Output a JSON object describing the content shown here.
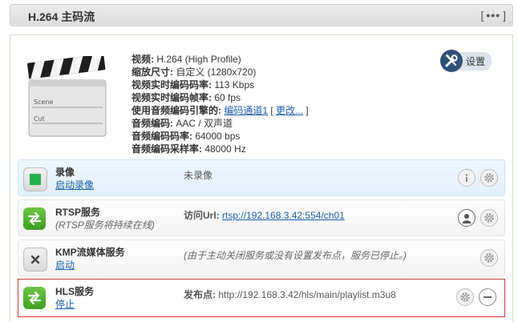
{
  "header": {
    "title": "H.264 主码流",
    "menu_open": "[",
    "menu_dots": "•••",
    "menu_close": "]"
  },
  "info": {
    "video_label": "视频:",
    "video_value": " H.264 (High Profile)",
    "scale_label": "缩放尺寸:",
    "scale_value": " 自定义 (1280x720)",
    "vbitrate_label": "视频实时编码码率:",
    "vbitrate_value": " 113 Kbps",
    "fps_label": "视频实时编码帧率:",
    "fps_value": " 60 fps",
    "engine_label": "使用音频编码引擎的:",
    "engine_link": "编码通道1",
    "engine_open": " [ ",
    "engine_change": "更改...",
    "engine_close": " ]",
    "aenc_label": "音频编码:",
    "aenc_value": " AAC / 双声道",
    "abitrate_label": "音频编码码率:",
    "abitrate_value": " 64000 bps",
    "asample_label": "音频编码采样率:",
    "asample_value": " 48000 Hz"
  },
  "clapper": {
    "scene": "Scene",
    "cut": "Cut"
  },
  "settings_button": {
    "label": "设置"
  },
  "services": {
    "record": {
      "name": "录像",
      "action": "启动录像",
      "status": "未录像"
    },
    "rtsp": {
      "name": "RTSP服务",
      "note": "(RTSP服务将持续在线)",
      "url_label": "访问Url:",
      "url": "rtsp://192.168.3.42:554/ch01"
    },
    "kmp": {
      "name": "KMP流媒体服务",
      "action": "启动",
      "status": "(由于主动关闭服务或没有设置发布点，服务已停止。)"
    },
    "hls": {
      "name": "HLS服务",
      "action": "停止",
      "url_label": "发布点:",
      "url": "http://192.168.3.42/hls/main/playlist.m3u8"
    }
  },
  "colors": {
    "accent": "#1a5fa8",
    "record_green": "#22b14c",
    "service_green": "#4caf2e",
    "selected_border": "#d23a3a"
  }
}
